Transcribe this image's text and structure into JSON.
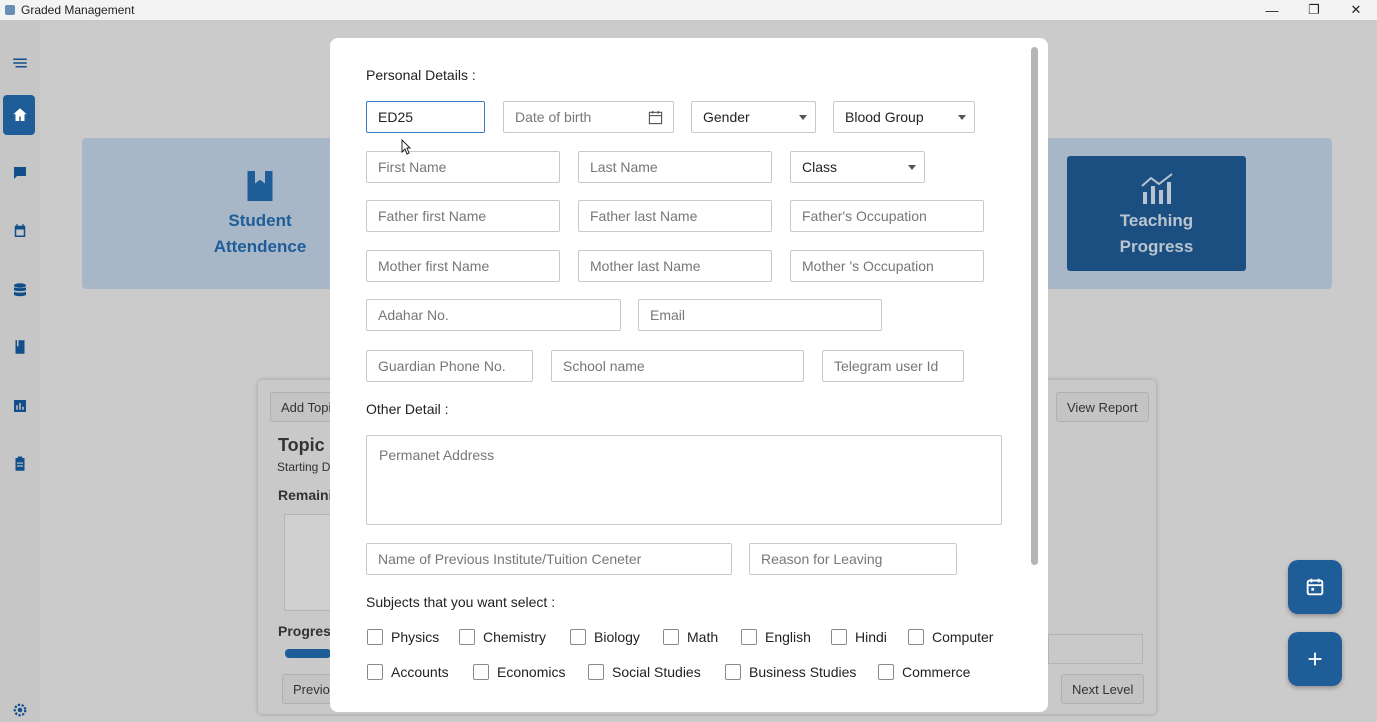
{
  "window": {
    "title": "Graded Management",
    "controls": [
      "—",
      "❐",
      "✕"
    ]
  },
  "dashboard": {
    "student_tile": {
      "line1": "Student",
      "line2": "Attendence"
    },
    "teaching_tile": {
      "line1": "Teaching",
      "line2": "Progress"
    },
    "add_topic": "Add Topi",
    "view_report": "View Report",
    "topic_title": "Topic",
    "starting_text": "Starting D",
    "remaining_text": "Remaini",
    "progress_text": "Progres",
    "previous_btn": "Previou",
    "next_level_btn": "Next Level"
  },
  "form": {
    "personal_details_label": "Personal Details :",
    "admission_no": {
      "value": "ED25"
    },
    "dob": {
      "placeholder": "Date of birth"
    },
    "gender": {
      "selected": "Gender"
    },
    "blood_group": {
      "selected": "Blood Group"
    },
    "first_name": {
      "placeholder": "First Name"
    },
    "last_name": {
      "placeholder": "Last Name"
    },
    "class": {
      "selected": "Class"
    },
    "father_first": {
      "placeholder": "Father first Name"
    },
    "father_last": {
      "placeholder": "Father last Name"
    },
    "father_occupation": {
      "placeholder": "Father's Occupation"
    },
    "mother_first": {
      "placeholder": "Mother first Name"
    },
    "mother_last": {
      "placeholder": "Mother last Name"
    },
    "mother_occupation": {
      "placeholder": "Mother 's Occupation"
    },
    "adahar": {
      "placeholder": "Adahar No."
    },
    "email": {
      "placeholder": "Email"
    },
    "guardian_phone": {
      "placeholder": "Guardian Phone No."
    },
    "school_name": {
      "placeholder": "School name"
    },
    "telegram": {
      "placeholder": "Telegram user Id"
    },
    "other_detail_label": "Other Detail :",
    "address": {
      "placeholder": "Permanet Address"
    },
    "previous_institute": {
      "placeholder": "Name of Previous Institute/Tuition Ceneter"
    },
    "reason_leaving": {
      "placeholder": "Reason for Leaving"
    },
    "subjects_label": "Subjects that you want select :",
    "subjects_row1": [
      "Physics",
      "Chemistry",
      "Biology",
      "Math",
      "English",
      "Hindi",
      "Computer"
    ],
    "subjects_row2": [
      "Accounts",
      "Economics",
      "Social Studies",
      "Business Studies",
      "Commerce"
    ]
  },
  "colors": {
    "primary": "#1f5d99",
    "accent_border": "#3b7bc2"
  }
}
